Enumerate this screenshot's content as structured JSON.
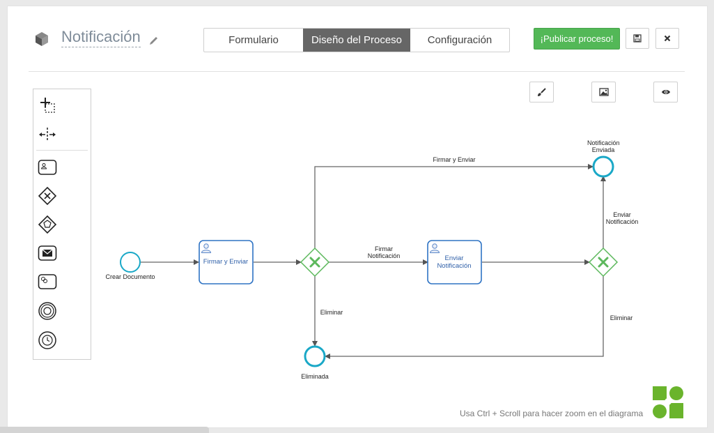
{
  "header": {
    "title": "Notificación",
    "icons": {
      "form": "cube-icon",
      "edit": "pencil-icon"
    }
  },
  "tabs": [
    {
      "label": "Formulario",
      "active": false
    },
    {
      "label": "Diseño del Proceso",
      "active": true
    },
    {
      "label": "Configuración",
      "active": false
    }
  ],
  "actions": {
    "publish_label": "¡Publicar proceso!",
    "save_icon": "floppy-icon",
    "close_icon": "close-icon"
  },
  "canvas_tools": [
    "brush-icon",
    "image-icon",
    "eye-icon"
  ],
  "toolbox": [
    "lasso-icon",
    "space-icon",
    "task-icon",
    "exclusive-gateway-icon",
    "event-gateway-icon",
    "message-event-icon",
    "service-task-icon",
    "intermediate-event-icon",
    "timer-event-icon"
  ],
  "diagram": {
    "start_event": "Crear Documento",
    "task1": "Firmar y Enviar",
    "task2": "Enviar Notificación",
    "end_sent": "Notificación Enviada",
    "end_deleted": "Eliminada",
    "flow_top": "Firmar y Enviar",
    "flow_middle": "Firmar Notificación",
    "flow_delete1": "Eliminar",
    "flow_send": "Enviar Notificación",
    "flow_delete2": "Eliminar"
  },
  "footer": {
    "hint": "Usa Ctrl + Scroll para hacer zoom en el diagrama"
  },
  "colors": {
    "active_tab": "#666666",
    "publish": "#53b857",
    "event": "#1aa8c7",
    "task": "#2e73c4",
    "gateway": "#5cb85c",
    "logo": "#6ab42c"
  }
}
